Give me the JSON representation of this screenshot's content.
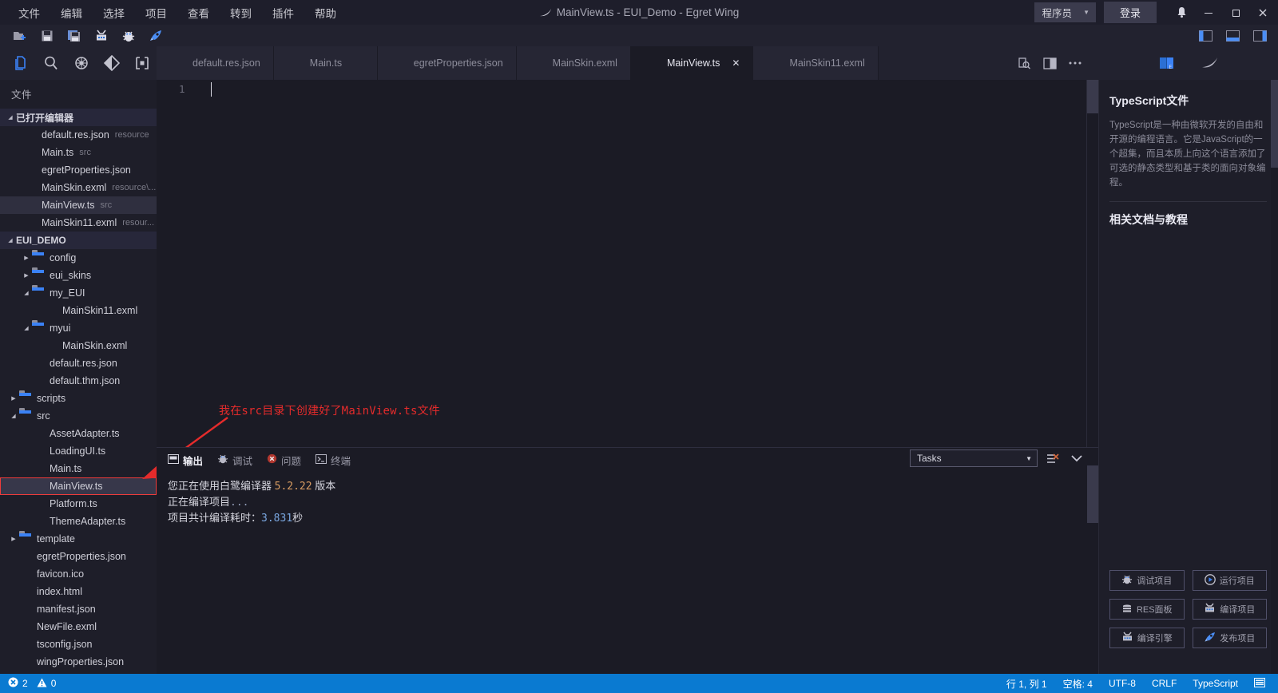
{
  "titlebar": {
    "menu": [
      "文件",
      "编辑",
      "选择",
      "项目",
      "查看",
      "转到",
      "插件",
      "帮助"
    ],
    "title": "MainView.ts - EUI_Demo - Egret Wing",
    "role": "程序员",
    "role_caret": "▼",
    "login": "登录",
    "bell_icon": "bell-icon",
    "minimize": "—",
    "maximize": "❐",
    "close": "✕"
  },
  "toolbar": {
    "buttons": [
      {
        "name": "new-file-icon"
      },
      {
        "name": "save-icon"
      },
      {
        "name": "save-all-icon"
      },
      {
        "name": "compile-icon"
      },
      {
        "name": "debug-icon"
      },
      {
        "name": "publish-icon"
      }
    ],
    "layout_buttons": [
      {
        "name": "toggle-sidebar-icon"
      },
      {
        "name": "toggle-panel-icon"
      },
      {
        "name": "toggle-rightbar-icon"
      }
    ]
  },
  "activitybar": {
    "items": [
      {
        "name": "explorer-icon"
      },
      {
        "name": "search-icon"
      },
      {
        "name": "debug-icon"
      },
      {
        "name": "source-control-icon"
      },
      {
        "name": "extensions-icon"
      }
    ]
  },
  "sidebar": {
    "title": "文件",
    "open_editors": {
      "label": "已打开编辑器",
      "twisty": "◢",
      "items": [
        {
          "label": "default.res.json",
          "sub": "resource",
          "icon": "json",
          "selected": false
        },
        {
          "label": "Main.ts",
          "sub": "src",
          "icon": "ts",
          "selected": false
        },
        {
          "label": "egretProperties.json",
          "sub": "",
          "icon": "json",
          "selected": false
        },
        {
          "label": "MainSkin.exml",
          "sub": "resource\\...",
          "icon": "ex",
          "selected": false
        },
        {
          "label": "MainView.ts",
          "sub": "src",
          "icon": "ts",
          "selected": true
        },
        {
          "label": "MainSkin11.exml",
          "sub": "resour...",
          "icon": "ex",
          "selected": false
        }
      ]
    },
    "project": {
      "label": "EUI_DEMO",
      "twisty": "◢",
      "tree": [
        {
          "label": "config",
          "type": "folder",
          "state": "closed",
          "indent": 1
        },
        {
          "label": "eui_skins",
          "type": "folder",
          "state": "closed",
          "indent": 1
        },
        {
          "label": "my_EUI",
          "type": "folder",
          "state": "open",
          "indent": 1
        },
        {
          "label": "MainSkin11.exml",
          "type": "file",
          "icon": "ex",
          "indent": 2
        },
        {
          "label": "myui",
          "type": "folder",
          "state": "open",
          "indent": 1
        },
        {
          "label": "MainSkin.exml",
          "type": "file",
          "icon": "ex",
          "indent": 2
        },
        {
          "label": "default.res.json",
          "type": "file",
          "icon": "json",
          "indent": 1
        },
        {
          "label": "default.thm.json",
          "type": "file",
          "icon": "json",
          "indent": 1
        },
        {
          "label": "scripts",
          "type": "folder",
          "state": "closed",
          "indent": 0
        },
        {
          "label": "src",
          "type": "folder",
          "state": "open",
          "indent": 0
        },
        {
          "label": "AssetAdapter.ts",
          "type": "file",
          "icon": "ts",
          "indent": 1
        },
        {
          "label": "LoadingUI.ts",
          "type": "file",
          "icon": "ts",
          "indent": 1
        },
        {
          "label": "Main.ts",
          "type": "file",
          "icon": "ts",
          "indent": 1
        },
        {
          "label": "MainView.ts",
          "type": "file",
          "icon": "ts",
          "indent": 1,
          "highlighted": true
        },
        {
          "label": "Platform.ts",
          "type": "file",
          "icon": "ts",
          "indent": 1
        },
        {
          "label": "ThemeAdapter.ts",
          "type": "file",
          "icon": "ts",
          "indent": 1
        },
        {
          "label": "template",
          "type": "folder",
          "state": "closed",
          "indent": 0
        },
        {
          "label": "egretProperties.json",
          "type": "file",
          "icon": "json",
          "indent": 0
        },
        {
          "label": "favicon.ico",
          "type": "file",
          "icon": "ico",
          "indent": 0
        },
        {
          "label": "index.html",
          "type": "file",
          "icon": "html",
          "indent": 0
        },
        {
          "label": "manifest.json",
          "type": "file",
          "icon": "json",
          "indent": 0
        },
        {
          "label": "NewFile.exml",
          "type": "file",
          "icon": "ex",
          "indent": 0
        },
        {
          "label": "tsconfig.json",
          "type": "file",
          "icon": "json",
          "indent": 0
        },
        {
          "label": "wingProperties.json",
          "type": "file",
          "icon": "json",
          "indent": 0
        }
      ]
    }
  },
  "tabs": [
    {
      "label": "default.res.json",
      "icon": "json",
      "active": false,
      "closable": false
    },
    {
      "label": "Main.ts",
      "icon": "ts",
      "active": false,
      "closable": false
    },
    {
      "label": "egretProperties.json",
      "icon": "json",
      "active": false,
      "closable": false
    },
    {
      "label": "MainSkin.exml",
      "icon": "ex",
      "active": false,
      "closable": false
    },
    {
      "label": "MainView.ts",
      "icon": "ts",
      "active": true,
      "closable": true,
      "close": "✕"
    },
    {
      "label": "MainSkin11.exml",
      "icon": "ex",
      "active": false,
      "closable": false
    }
  ],
  "tab_actions": [
    {
      "name": "preview-icon"
    },
    {
      "name": "split-editor-icon"
    },
    {
      "name": "more-actions-icon"
    }
  ],
  "editor": {
    "line_number": "1",
    "content": "",
    "annotation": "我在src目录下创建好了MainView.ts文件"
  },
  "panel": {
    "tabs": [
      {
        "label": "输出",
        "icon": "output-icon",
        "active": true
      },
      {
        "label": "调试",
        "icon": "debug-icon",
        "active": false
      },
      {
        "label": "问题",
        "icon": "problems-icon",
        "active": false
      },
      {
        "label": "终端",
        "icon": "terminal-icon",
        "active": false
      }
    ],
    "task_select": {
      "value": "Tasks",
      "caret": "▼"
    },
    "actions": [
      {
        "name": "clear-output-icon"
      },
      {
        "name": "collapse-panel-icon"
      }
    ],
    "output_lines": [
      {
        "prefix": "您正在使用白鹭编译器 ",
        "num": "5.2.22",
        "suffix": " 版本"
      },
      {
        "prefix": "正在编译项目",
        "dots": "...",
        "suffix": ""
      },
      {
        "prefix": "项目共计编译耗时：",
        "num": "3.831",
        "suffix": "秒"
      }
    ]
  },
  "rightpanel": {
    "tabs": [
      {
        "name": "docs-icon"
      },
      {
        "name": "egret-wing-icon"
      }
    ],
    "heading": "TypeScript文件",
    "paragraph": "TypeScript是一种由微软开发的自由和开源的编程语言。它是JavaScript的一个超集，而且本质上向这个语言添加了可选的静态类型和基于类的面向对象编程。",
    "subheading": "相关文档与教程",
    "buttons": [
      {
        "label": "调试项目",
        "icon": "debug-icon"
      },
      {
        "label": "运行项目",
        "icon": "run-icon"
      },
      {
        "label": "RES面板",
        "icon": "res-panel-icon"
      },
      {
        "label": "编译项目",
        "icon": "compile-icon"
      },
      {
        "label": "编译引擎",
        "icon": "compile-engine-icon"
      },
      {
        "label": "发布项目",
        "icon": "publish-icon"
      }
    ]
  },
  "statusbar": {
    "error_icon": "error-icon",
    "errors": "2",
    "warning_icon": "warning-icon",
    "warnings": "0",
    "right_items": [
      "行 1, 列 1",
      "空格: 4",
      "UTF-8",
      "CRLF",
      "TypeScript"
    ],
    "notify_icon": "notification-icon"
  },
  "colors": {
    "accent": "#0a7ad1",
    "annotation_red": "#e52b2b",
    "bg": "#1b1b25",
    "chrome": "#22222f"
  }
}
